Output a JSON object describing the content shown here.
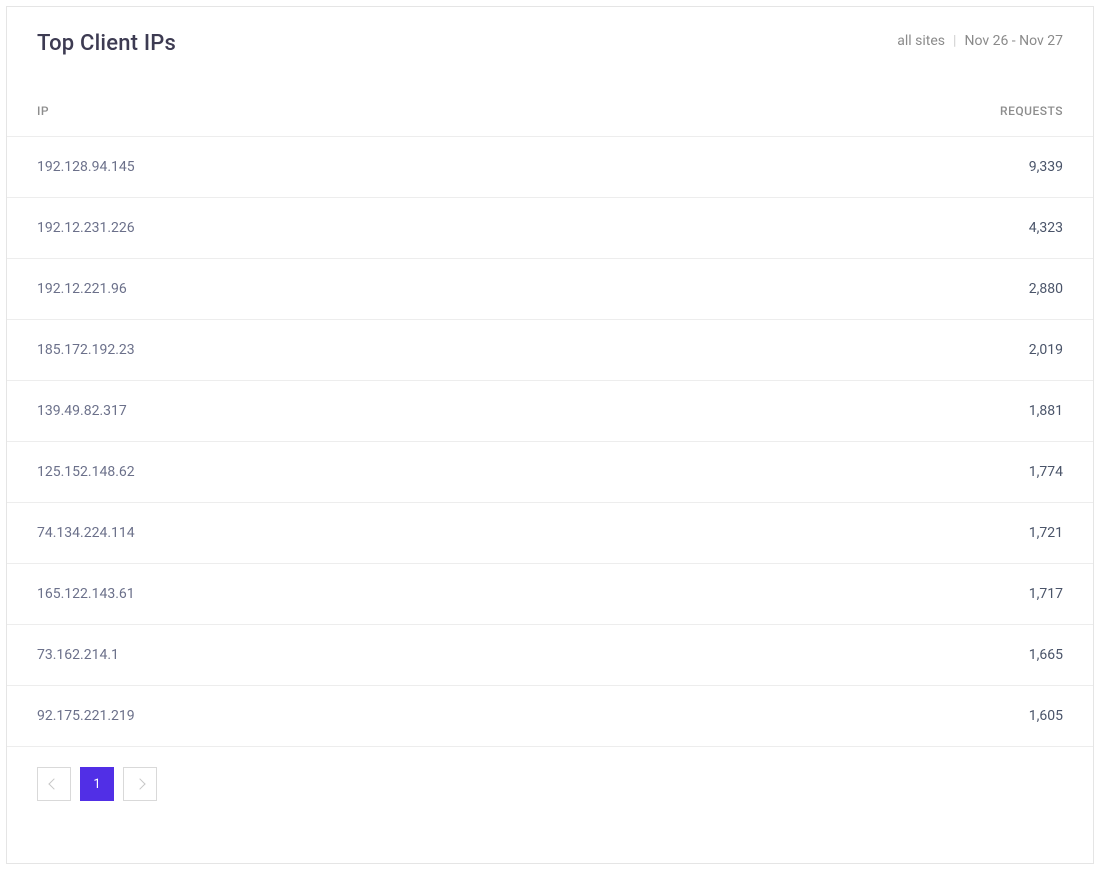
{
  "header": {
    "title": "Top Client IPs",
    "meta_sites": "all sites",
    "meta_range": "Nov 26 - Nov 27"
  },
  "table": {
    "col_ip": "IP",
    "col_requests": "REQUESTS",
    "rows": [
      {
        "ip": "192.128.94.145",
        "requests": "9,339"
      },
      {
        "ip": "192.12.231.226",
        "requests": "4,323"
      },
      {
        "ip": "192.12.221.96",
        "requests": "2,880"
      },
      {
        "ip": "185.172.192.23",
        "requests": "2,019"
      },
      {
        "ip": "139.49.82.317",
        "requests": "1,881"
      },
      {
        "ip": "125.152.148.62",
        "requests": "1,774"
      },
      {
        "ip": "74.134.224.114",
        "requests": "1,721"
      },
      {
        "ip": "165.122.143.61",
        "requests": "1,717"
      },
      {
        "ip": "73.162.214.1",
        "requests": "1,665"
      },
      {
        "ip": "92.175.221.219",
        "requests": "1,605"
      }
    ]
  },
  "pagination": {
    "page1": "1"
  }
}
